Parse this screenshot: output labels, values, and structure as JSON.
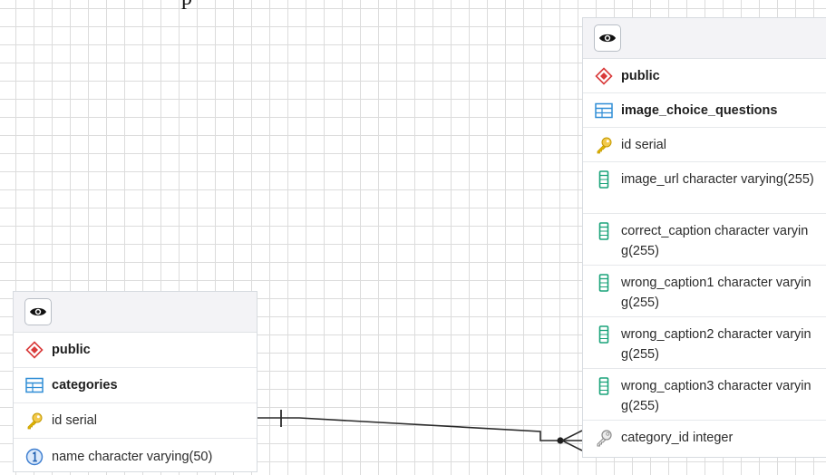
{
  "diagram": {
    "top_fragment": "p",
    "tables": [
      {
        "schema": "public",
        "name": "categories",
        "columns": [
          {
            "text": "id serial",
            "kind": "primary-key"
          },
          {
            "text": "name character varying(50)",
            "kind": "unique"
          }
        ]
      },
      {
        "schema": "public",
        "name": "image_choice_questions",
        "columns": [
          {
            "text": "id serial",
            "kind": "primary-key"
          },
          {
            "text": "image_url character varying(255)",
            "kind": "column"
          },
          {
            "text": "correct_caption character varying(255)",
            "kind": "column"
          },
          {
            "text": "wrong_caption1 character varying(255)",
            "kind": "column"
          },
          {
            "text": "wrong_caption2 character varying(255)",
            "kind": "column"
          },
          {
            "text": "wrong_caption3 character varying(255)",
            "kind": "column"
          },
          {
            "text": "category_id integer",
            "kind": "foreign-key"
          }
        ]
      }
    ],
    "relationship": {
      "from": "categories",
      "to": "image_choice_questions",
      "cardinality_from": "one",
      "cardinality_to": "many"
    },
    "icons": {
      "visibility": "eye-icon",
      "schema": "schema-icon",
      "table": "table-icon",
      "primary_key": "key-icon",
      "unique": "unique-constraint-icon",
      "column": "column-icon",
      "foreign_key": "foreign-key-icon"
    },
    "colors": {
      "schema": "#d93a3a",
      "table": "#2f8dd6",
      "primary_key": "#e0b400",
      "unique": "#3f7fd0",
      "column": "#1aa37a",
      "foreign_key": "#9a9a9a",
      "grid": "#dcdcdc"
    }
  }
}
